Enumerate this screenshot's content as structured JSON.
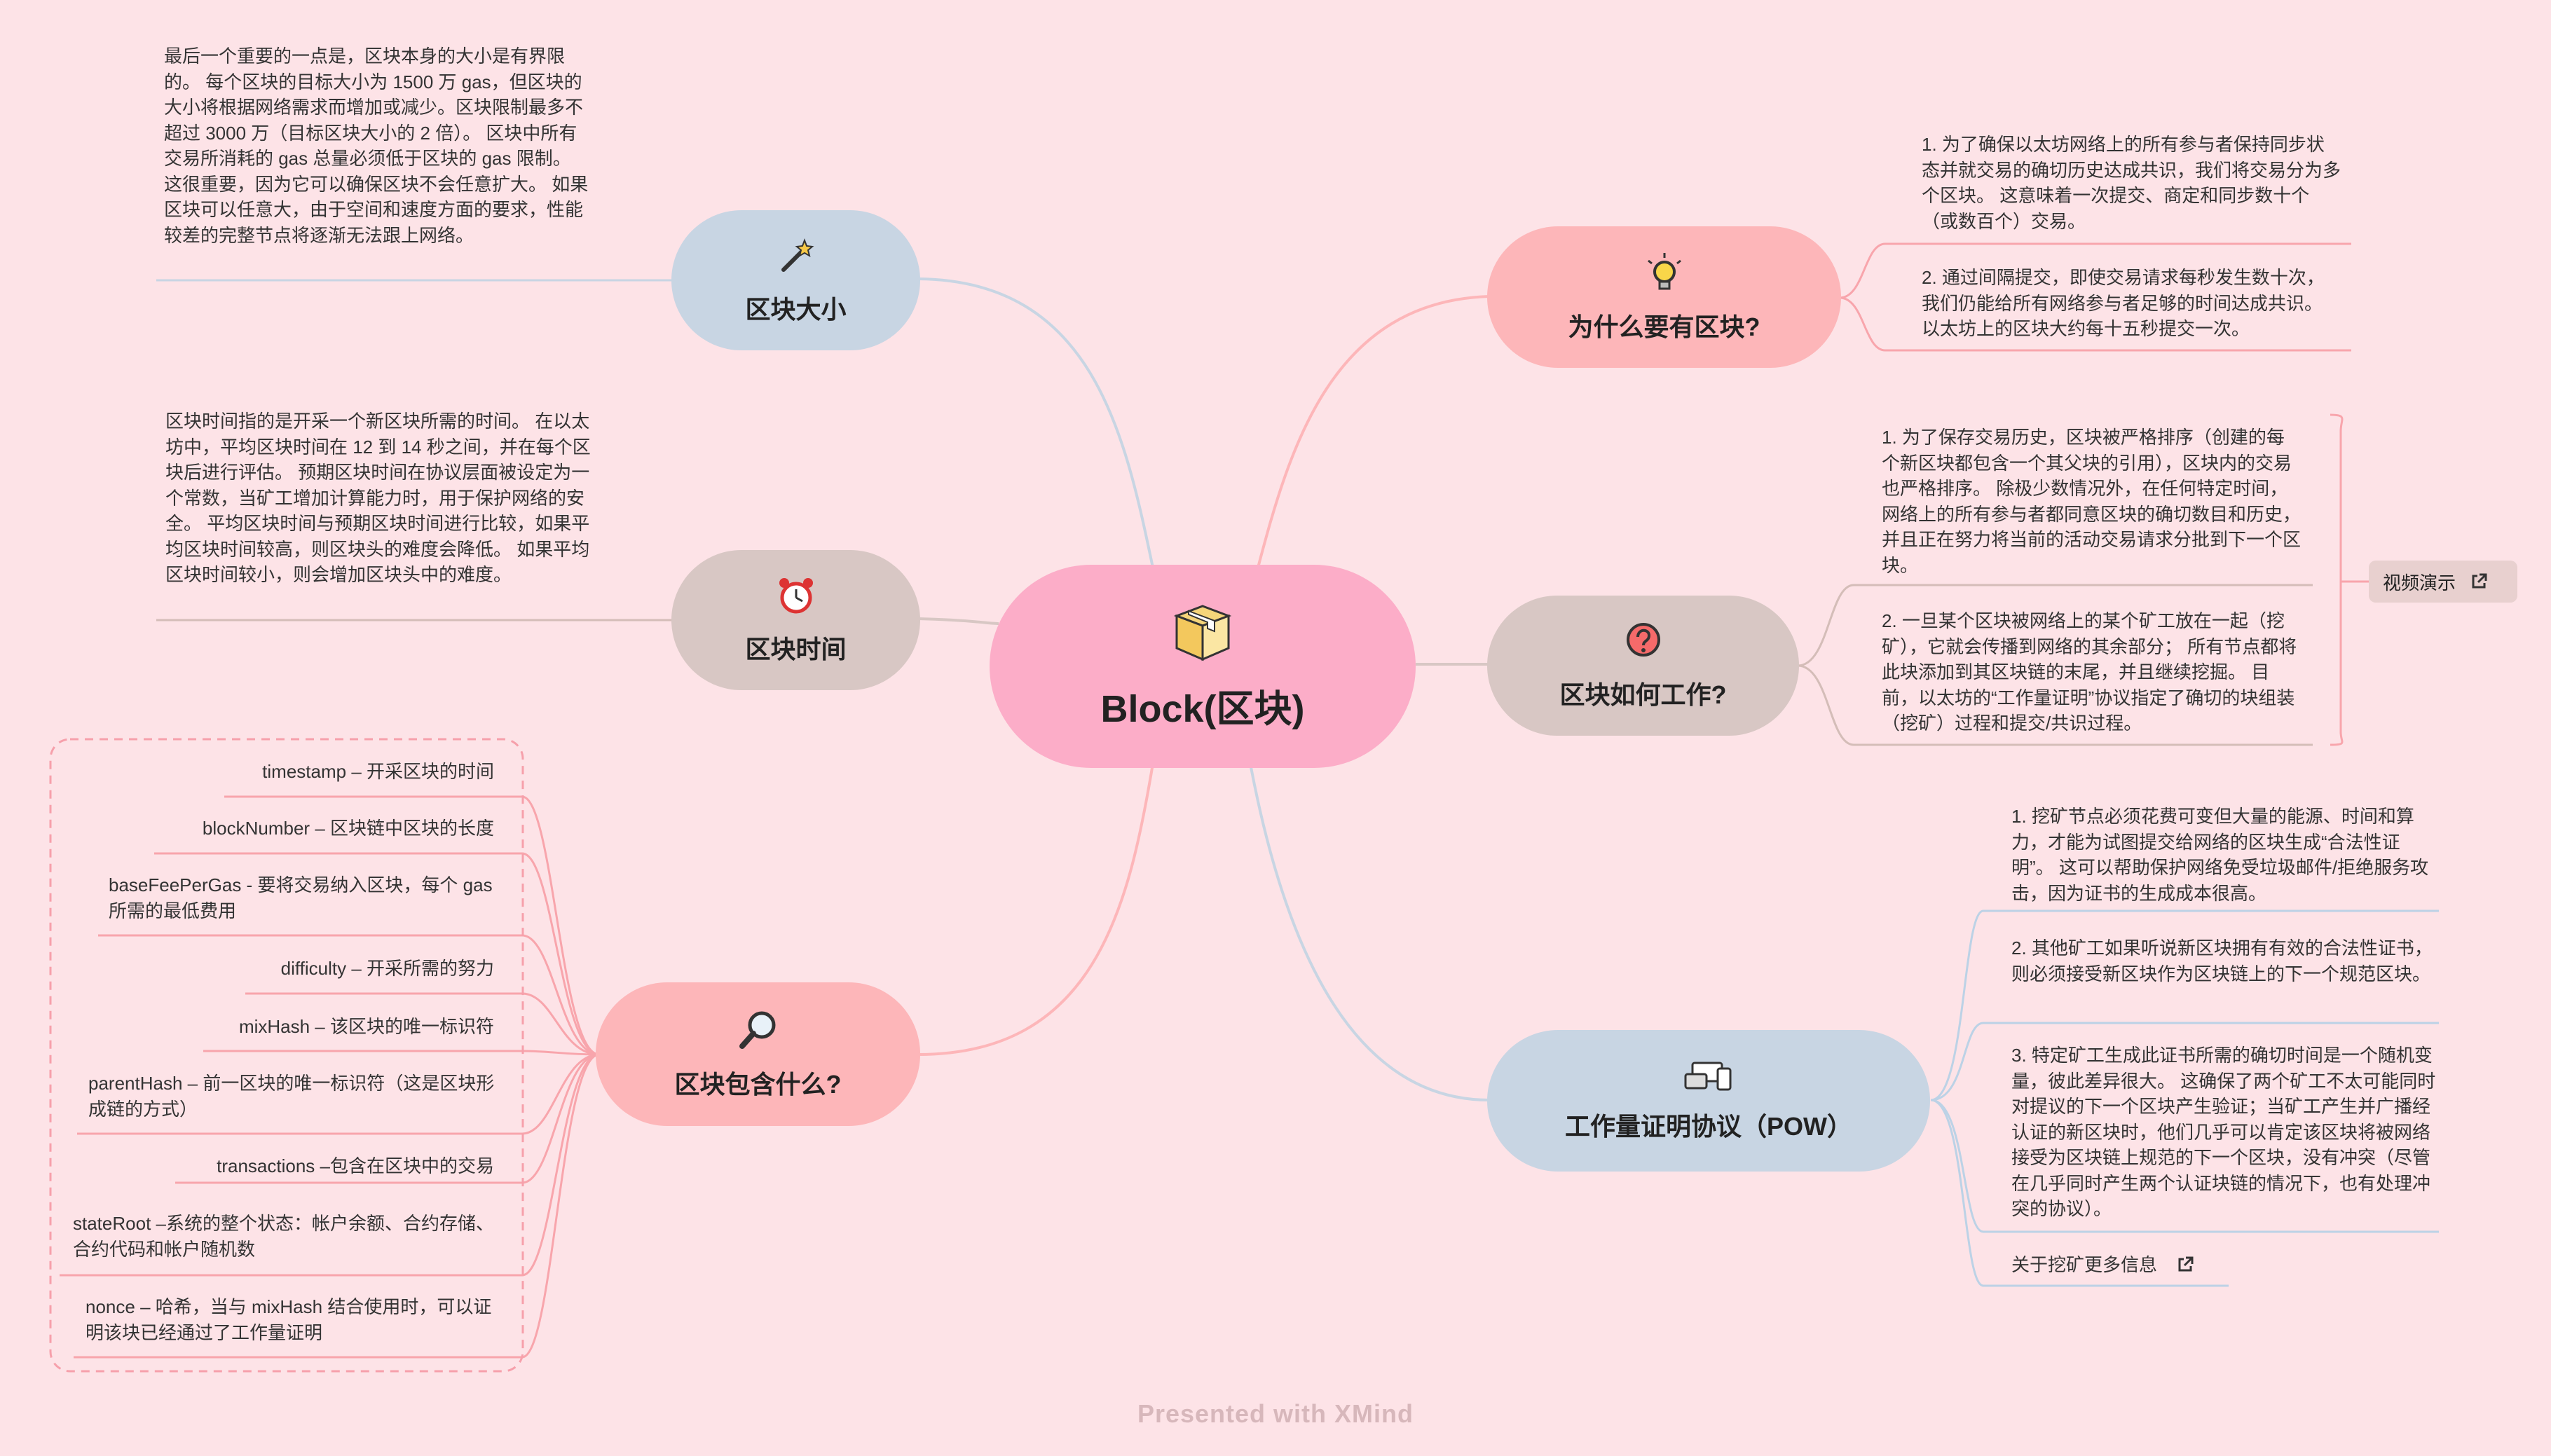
{
  "root": {
    "title": "Block(区块)"
  },
  "topics": {
    "size": {
      "label": "区块大小",
      "icon": "magic-wand-icon",
      "note": "最后一个重要的一点是，区块本身的大小是有界限的。 每个区块的目标大小为 1500 万 gas，但区块的大小将根据网络需求而增加或减少。区块限制最多不超过 3000 万（目标区块大小的 2 倍）。 区块中所有交易所消耗的 gas 总量必须低于区块的 gas 限制。 这很重要，因为它可以确保区块不会任意扩大。 如果区块可以任意大，由于空间和速度方面的要求，性能较差的完整节点将逐渐无法跟上网络。"
    },
    "time": {
      "label": "区块时间",
      "icon": "alarm-clock-icon",
      "note": "区块时间指的是开采一个新区块所需的时间。 在以太坊中，平均区块时间在 12 到 14 秒之间，并在每个区块后进行评估。 预期区块时间在协议层面被设定为一个常数，当矿工增加计算能力时，用于保护网络的安全。 平均区块时间与预期区块时间进行比较，如果平均区块时间较高，则区块头的难度会降低。 如果平均区块时间较小，则会增加区块头中的难度。"
    },
    "contains": {
      "label": "区块包含什么?",
      "icon": "magnifier-icon",
      "items": [
        "timestamp – 开采区块的时间",
        "blockNumber – 区块链中区块的长度",
        "baseFeePerGas - 要将交易纳入区块，每个 gas 所需的最低费用",
        "difficulty – 开采所需的努力",
        "mixHash – 该区块的唯一标识符",
        "parentHash – 前一区块的唯一标识符（这是区块形成链的方式）",
        "transactions –包含在区块中的交易",
        "stateRoot –系统的整个状态：帐户余额、合约存储、合约代码和帐户随机数",
        "nonce – 哈希，当与 mixHash 结合使用时，可以证明该块已经通过了工作量证明"
      ]
    },
    "why": {
      "label": "为什么要有区块?",
      "icon": "lightbulb-icon",
      "notes": [
        "1. 为了确保以太坊网络上的所有参与者保持同步状态并就交易的确切历史达成共识，我们将交易分为多个区块。 这意味着一次提交、商定和同步数十个（或数百个）交易。",
        "2. 通过间隔提交，即使交易请求每秒发生数十次，我们仍能给所有网络参与者足够的时间达成共识。 以太坊上的区块大约每十五秒提交一次。"
      ]
    },
    "how": {
      "label": "区块如何工作?",
      "icon": "question-icon",
      "notes": [
        "1. 为了保存交易历史，区块被严格排序（创建的每个新区块都包含一个其父块的引用），区块内的交易也严格排序。 除极少数情况外，在任何特定时间，网络上的所有参与者都同意区块的确切数目和历史， 并且正在努力将当前的活动交易请求分批到下一个区块。",
        "2. 一旦某个区块被网络上的某个矿工放在一起（挖矿），它就会传播到网络的其余部分； 所有节点都将此块添加到其区块链的末尾，并且继续挖掘。 目前，以太坊的“工作量证明”协议指定了确切的块组装（挖矿）过程和提交/共识过程。"
      ],
      "link": "视频演示"
    },
    "pow": {
      "label": "工作量证明协议（POW）",
      "icon": "devices-icon",
      "notes": [
        "1. 挖矿节点必须花费可变但大量的能源、时间和算力，才能为试图提交给网络的区块生成“合法性证明”。 这可以帮助保护网络免受垃圾邮件/拒绝服务攻击，因为证书的生成成本很高。",
        "2. 其他矿工如果听说新区块拥有有效的合法性证书，则必须接受新区块作为区块链上的下一个规范区块。",
        "3. 特定矿工生成此证书所需的确切时间是一个随机变量，彼此差异很大。 这确保了两个矿工不太可能同时对提议的下一个区块产生验证；当矿工产生并广播经认证的新区块时，他们几乎可以肯定该区块将被网络接受为区块链上规范的下一个区块，没有冲突（尽管在几乎同时产生两个认证块链的情况下，也有处理冲突的协议）。"
      ],
      "link": "关于挖矿更多信息"
    }
  },
  "footer": "Presented with XMind",
  "colors": {
    "background": "#fde3e7",
    "root": "#fcadc8",
    "pink": "#fdb6b9",
    "blue": "#c8d5e3",
    "taupe": "#d8c7c4",
    "accent_pink": "#f8a5ac",
    "accent_blue": "#bcd2e6",
    "accent_taupe": "#d4bdb8"
  }
}
